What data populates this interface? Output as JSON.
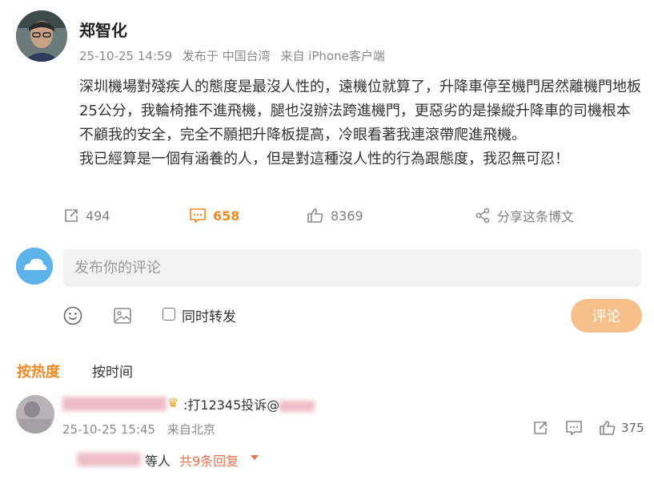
{
  "post": {
    "author": "郑智化",
    "meta": {
      "date": "25-10-25 14:59",
      "location": "发布于 中国台湾",
      "source": "来自 iPhone客户端"
    },
    "paragraphs": [
      "深圳機場對殘疾人的態度是最沒人性的，遠機位就算了，升降車停至機門居然離機門地板25公分，我輪椅推不進飛機，腿也沒辦法跨進機門，更惡劣的是操縱升降車的司機根本不顧我的安全，完全不願把升降板提高，冷眼看著我連滾帶爬進飛機。",
      "我已經算是一個有涵養的人，但是對這種沒人性的行為跟態度，我忍無可忍！"
    ],
    "actions": {
      "repost": "494",
      "comments": "658",
      "likes": "8369",
      "share": "分享这条博文"
    }
  },
  "composer": {
    "placeholder": "发布你的评论",
    "repost_label": "同时转发",
    "submit": "评论"
  },
  "sort": {
    "hot": "按热度",
    "time": "按时间"
  },
  "comment": {
    "text": ":打12345投诉@",
    "date": "25-10-25 15:45",
    "location": "来自北京",
    "likes": "375",
    "replies_who": "等人",
    "replies_count": "共9条回复"
  },
  "icons": {
    "repost": "repost-icon",
    "comment": "comment-icon",
    "like": "thumbs-up-icon",
    "share": "share-icon",
    "emoji": "smile-icon",
    "image": "image-icon",
    "crown": "crown-icon"
  },
  "colors": {
    "accent": "#f08a24",
    "reply_link": "#eb7350",
    "submit_disabled": "#f7c08a",
    "input_bg": "#f2f2f2"
  }
}
